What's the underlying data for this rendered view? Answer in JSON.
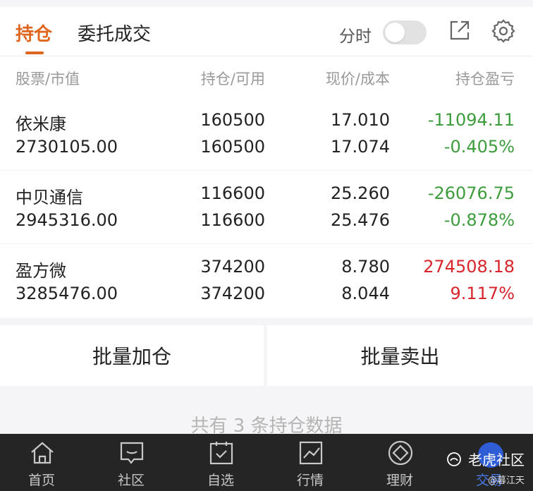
{
  "tabs": {
    "active": "持仓",
    "other": "委托成交",
    "fenshi": "分时"
  },
  "header": {
    "col1": "股票/市值",
    "col2": "持仓/可用",
    "col3": "现价/成本",
    "col4": "持仓盈亏"
  },
  "rows": [
    {
      "name": "依米康",
      "market_value": "2730105.00",
      "position": "160500",
      "available": "160500",
      "price": "17.010",
      "cost": "17.074",
      "pl": "-11094.11",
      "pl_pct": "-0.405%",
      "trend": "down"
    },
    {
      "name": "中贝通信",
      "market_value": "2945316.00",
      "position": "116600",
      "available": "116600",
      "price": "25.260",
      "cost": "25.476",
      "pl": "-26076.75",
      "pl_pct": "-0.878%",
      "trend": "down"
    },
    {
      "name": "盈方微",
      "market_value": "3285476.00",
      "position": "374200",
      "available": "374200",
      "price": "8.780",
      "cost": "8.044",
      "pl": "274508.18",
      "pl_pct": "9.117%",
      "trend": "up"
    }
  ],
  "actions": {
    "add": "批量加仓",
    "sell": "批量卖出"
  },
  "summary": "共有 3 条持仓数据",
  "tabbar": [
    {
      "label": "首页",
      "icon": "home-icon"
    },
    {
      "label": "社区",
      "icon": "chat-icon"
    },
    {
      "label": "自选",
      "icon": "checklist-icon"
    },
    {
      "label": "行情",
      "icon": "chart-icon"
    },
    {
      "label": "理财",
      "icon": "diamond-icon"
    },
    {
      "label": "交易",
      "icon": "yen-icon"
    }
  ],
  "watermark": {
    "brand": "老虎社区",
    "user": "@暮江天"
  },
  "colors": {
    "accent": "#e0661f",
    "up": "#d8252b",
    "down": "#3d9c3c"
  }
}
